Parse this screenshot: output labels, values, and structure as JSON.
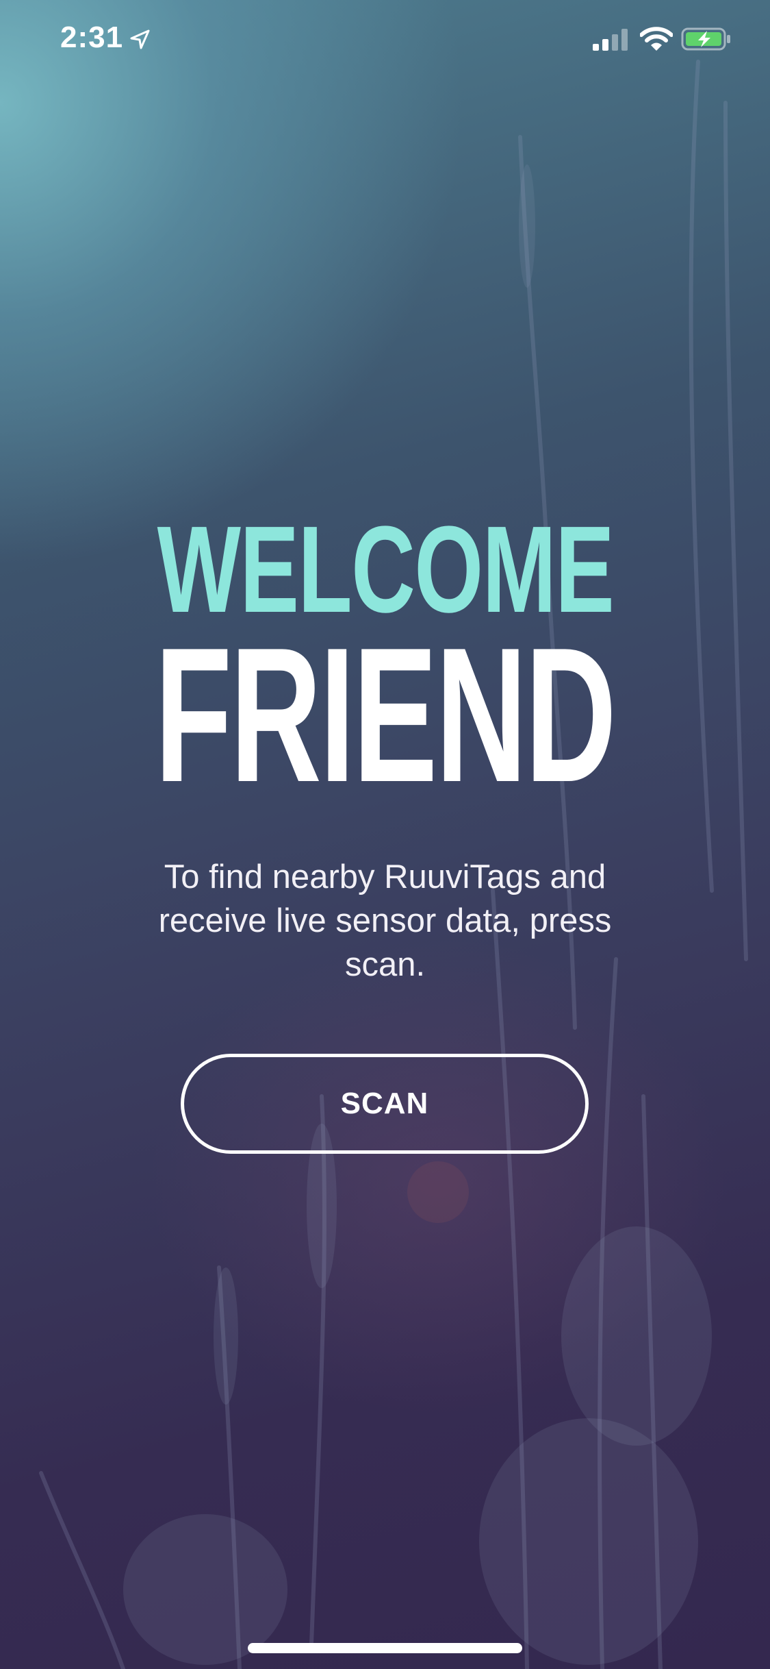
{
  "status_bar": {
    "time": "2:31",
    "location_icon": "location-arrow-icon",
    "signal_icon": "cellular-signal-icon",
    "wifi_icon": "wifi-icon",
    "battery_icon": "battery-charging-icon",
    "battery_color": "#5fd26b"
  },
  "welcome": {
    "title_line1": "WELCOME",
    "title_line2": "FRIEND",
    "title_line1_color": "#8de6dc",
    "description": "To find nearby RuuviTags and receive live sensor data, press scan.",
    "scan_button_label": "SCAN"
  }
}
